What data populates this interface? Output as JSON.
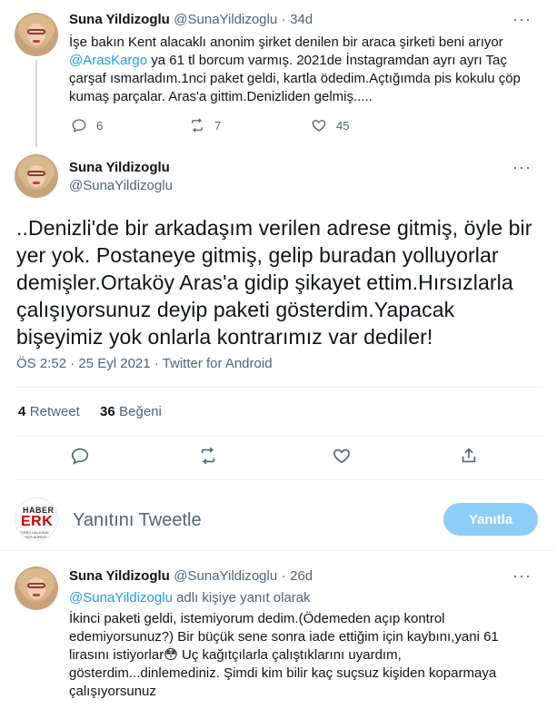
{
  "tweet1": {
    "author_name": "Suna Yildizoglu",
    "author_handle": "@SunaYildizoglu",
    "separator": "·",
    "time": "34d",
    "line1": "İşe bakın Kent alacaklı anonim şirket denilen bir araca şirketi beni arıyor",
    "mention": "@ArasKargo",
    "line2_rest": " ya 61 tl borcum varmış. 2021de İnstagramdan ayrı ayrı Taç",
    "line3": "çarşaf ısmarladım.1nci paket geldi, kartla ödedim.Açtığımda pis kokulu çöp",
    "line4": "kumaş parçalar. Aras'a gittim.Denizliden gelmiş.....",
    "reply_count": "6",
    "retweet_count": "7",
    "like_count": "45",
    "more": "···"
  },
  "tweet2": {
    "author_name": "Suna Yildizoglu",
    "author_handle": "@SunaYildizoglu",
    "more": "···",
    "line1": "..Denizli'de bir arkadaşım verilen adrese gitmiş, öyle bir",
    "line2": "yer yok. Postaneye gitmiş, gelip buradan yolluyorlar",
    "line3": "demişler.Ortaköy Aras'a gidip şikayet ettim.Hırsızlarla",
    "line4": "çalışıyorsunuz deyip paketi gösterdim.Yapacak",
    "line5": "bişeyimiz yok onlarla kontrarımız var dediler!",
    "meta": "ÖS 2:52 · 25 Eyl 2021 · Twitter for Android",
    "retweets_num": "4",
    "retweets_label": "Retweet",
    "likes_num": "36",
    "likes_label": "Beğeni"
  },
  "reply_box": {
    "placeholder": "Yanıtını Tweetle",
    "button": "Yanıtla",
    "logo_top": "HABER",
    "logo_main": "ERK",
    "logo_tag": "TÜRKİ HALKININ HABER ADRESİ"
  },
  "tweet3": {
    "author_name": "Suna Yildizoglu",
    "author_handle": "@SunaYildizoglu",
    "separator": "·",
    "time": "26d",
    "more": "···",
    "reply_to_mention": "@SunaYildizoglu",
    "reply_to_rest": " adlı kişiye yanıt olarak",
    "line1": "İkinci paketi geldi, istemiyorum dedim.(Ödemeden açıp kontrol",
    "line2": "edemiyorsunuz?) Bir büçük sene sonra iade ettiğim için kaybını,yani 61",
    "line3a": "lirasını istiyorlar",
    "emoji": "😳",
    "line3b": " Uç kağıtçılarla çalıştıklarını uyardım,",
    "line4": "gösterdim...dinlemediniz. Şimdi kim bilir kaç suçsuz kişiden koparmaya",
    "line5": "çalışıyorsunuz"
  },
  "colors": {
    "accent": "#1d9bf0",
    "muted": "#536471",
    "divider": "#eff3f4",
    "reply_button": "#8ecdf8",
    "thread_line": "#cfd9de"
  }
}
